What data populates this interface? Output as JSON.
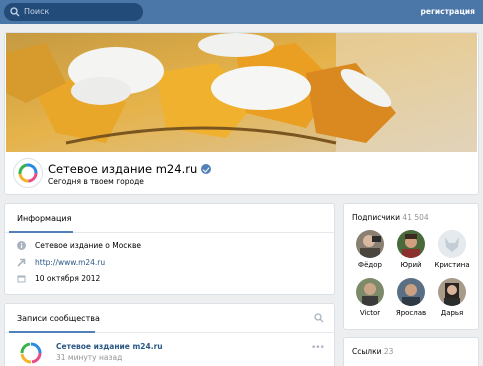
{
  "header": {
    "search_placeholder": "Поиск",
    "register_label": "регистрация",
    "bar_color": "#4a76a8"
  },
  "profile": {
    "name": "Сетевое издание m24.ru",
    "status": "Сегодня в твоем городе",
    "verified_icon": "verified-check-icon"
  },
  "info": {
    "tab_label": "Информация",
    "description": "Сетевое издание о Москве",
    "website": "http://www.m24.ru",
    "created": "10 октября 2012"
  },
  "posts": {
    "tab_label": "Записи сообщества",
    "post_author": "Сетевое издание m24.ru",
    "post_time": "31 минуту назад",
    "more_label": "•••"
  },
  "subscribers": {
    "label": "Подписчики",
    "count": "41 504",
    "members": [
      {
        "name": "Фёдор"
      },
      {
        "name": "Юрий"
      },
      {
        "name": "Кристина"
      },
      {
        "name": "Victor"
      },
      {
        "name": "Ярослав"
      },
      {
        "name": "Дарья"
      }
    ]
  },
  "links": {
    "label": "Ссылки",
    "count": "23"
  }
}
